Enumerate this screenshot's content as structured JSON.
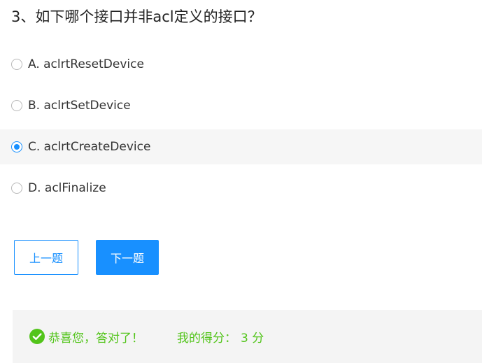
{
  "question": {
    "title": "3、如下哪个接口并非acl定义的接口？"
  },
  "options": [
    {
      "label": "A. aclrtResetDevice",
      "selected": false
    },
    {
      "label": "B. aclrtSetDevice",
      "selected": false
    },
    {
      "label": "C. aclrtCreateDevice",
      "selected": true
    },
    {
      "label": "D. aclFinalize",
      "selected": false
    }
  ],
  "buttons": {
    "prev_label": "上一题",
    "next_label": "下一题"
  },
  "result": {
    "message": "恭喜您，答对了！",
    "score_label": "我的得分：",
    "score_value": "3 分",
    "icon": "check-circle-icon"
  },
  "colors": {
    "accent": "#1890ff",
    "success": "#52c41a",
    "selected_row_bg": "#f6f6f6",
    "result_bg": "#f4f4f4"
  }
}
